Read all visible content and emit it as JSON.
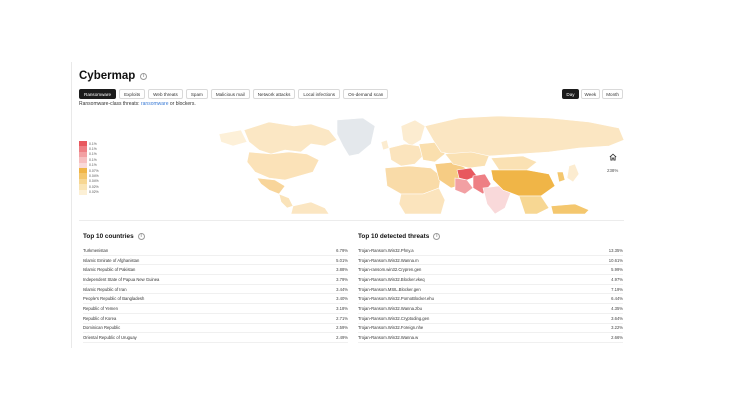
{
  "page": {
    "title": "Cybermap"
  },
  "tabs": [
    {
      "label": "Ransomware",
      "active": true
    },
    {
      "label": "Exploits",
      "active": false
    },
    {
      "label": "Web threats",
      "active": false
    },
    {
      "label": "Spam",
      "active": false
    },
    {
      "label": "Malicious mail",
      "active": false
    },
    {
      "label": "Network attacks",
      "active": false
    },
    {
      "label": "Local infections",
      "active": false
    },
    {
      "label": "On-demand scan",
      "active": false
    }
  ],
  "period": [
    {
      "label": "Day",
      "active": true
    },
    {
      "label": "Week",
      "active": false
    },
    {
      "label": "Month",
      "active": false
    }
  ],
  "subtitle": {
    "text": "Ransomware-class threats:",
    "link": "ransomware",
    "suffix": "or blockers."
  },
  "legend": [
    {
      "label": "0.1%",
      "color": "#e8585e"
    },
    {
      "label": "0.1%",
      "color": "#ee7f84"
    },
    {
      "label": "0.1%",
      "color": "#f2a0a3"
    },
    {
      "label": "0.1%",
      "color": "#f6bfc0"
    },
    {
      "label": "0.1%",
      "color": "#f9d9da"
    },
    {
      "label": "0.07%",
      "color": "#f0b547"
    },
    {
      "label": "0.04%",
      "color": "#f4c76e"
    },
    {
      "label": "0.04%",
      "color": "#f7d793"
    },
    {
      "label": "0.02%",
      "color": "#fae5b6"
    },
    {
      "label": "0.02%",
      "color": "#fcf0d6"
    }
  ],
  "map": {
    "zoom_label": "238%"
  },
  "top_countries": {
    "title": "Top 10 countries",
    "rows": [
      {
        "name": "Turkmenistan",
        "value": "6.79%"
      },
      {
        "name": "Islamic Emirate of Afghanistan",
        "value": "5.01%"
      },
      {
        "name": "Islamic Republic of Pakistan",
        "value": "3.88%"
      },
      {
        "name": "Independent State of Papua New Guinea",
        "value": "3.79%"
      },
      {
        "name": "Islamic Republic of Iran",
        "value": "3.44%"
      },
      {
        "name": "People's Republic of Bangladesh",
        "value": "3.40%"
      },
      {
        "name": "Republic of Yemen",
        "value": "3.18%"
      },
      {
        "name": "Republic of Korea",
        "value": "2.71%"
      },
      {
        "name": "Dominican Republic",
        "value": "2.59%"
      },
      {
        "name": "Oriental Republic of Uruguay",
        "value": "2.49%"
      }
    ]
  },
  "top_threats": {
    "title": "Top 10 detected threats",
    "rows": [
      {
        "name": "Trojan-Ransom.Win32.Phny.a",
        "value": "13.35%"
      },
      {
        "name": "Trojan-Ransom.Win32.Wanna.m",
        "value": "10.61%"
      },
      {
        "name": "Trojan-ransom.win32.Crypren.gen",
        "value": "5.99%"
      },
      {
        "name": "Trojan-Ransom.Win32.Blocker.vkeq",
        "value": "4.97%"
      },
      {
        "name": "Trojan-Ransom.MSIL.Blocker.gen",
        "value": "7.19%"
      },
      {
        "name": "Trojan-Ransom.Win32.PornoBlocker.ehu",
        "value": "6.44%"
      },
      {
        "name": "Trojan-Ransom.Win32.Wanna.zbu",
        "value": "4.35%"
      },
      {
        "name": "Trojan-Ransom.Win32.Cryptoding.gen",
        "value": "3.64%"
      },
      {
        "name": "Trojan-Ransom.Win32.Foreign.nhe",
        "value": "3.22%"
      },
      {
        "name": "Trojan-Ransom.Win32.Wanna.w",
        "value": "2.66%"
      }
    ]
  }
}
